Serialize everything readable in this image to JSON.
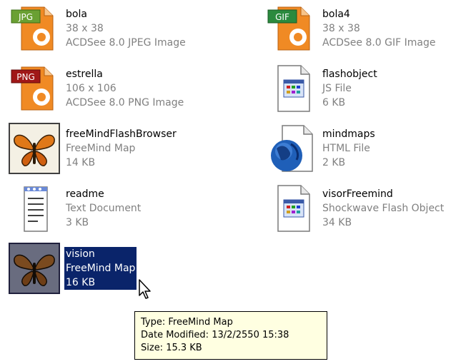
{
  "files": [
    {
      "name": "bola",
      "line2": "38 x 38",
      "line3": "ACDSee 8.0 JPEG Image",
      "icon": "jpg-image-icon",
      "badge": "JPG",
      "badge_color": "#6aa033"
    },
    {
      "name": "bola4",
      "line2": "38 x 38",
      "line3": "ACDSee 8.0 GIF Image",
      "icon": "gif-image-icon",
      "badge": "GIF",
      "badge_color": "#2b8a3e"
    },
    {
      "name": "estrella",
      "line2": "106 x 106",
      "line3": "ACDSee 8.0 PNG Image",
      "icon": "png-image-icon",
      "badge": "PNG",
      "badge_color": "#a01818"
    },
    {
      "name": "flashobject",
      "line2": "JS File",
      "line3": "6 KB",
      "icon": "script-file-icon"
    },
    {
      "name": "freeMindFlashBrowser",
      "line2": "FreeMind Map",
      "line3": "14 KB",
      "icon": "butterfly-icon"
    },
    {
      "name": "mindmaps",
      "line2": "HTML File",
      "line3": "2 KB",
      "icon": "html-globe-icon"
    },
    {
      "name": "readme",
      "line2": "Text Document",
      "line3": "3 KB",
      "icon": "text-document-icon"
    },
    {
      "name": "visorFreemind",
      "line2": "Shockwave Flash Object",
      "line3": "34 KB",
      "icon": "flash-object-icon"
    },
    {
      "name": "vision",
      "line2": "FreeMind Map",
      "line3": "16 KB",
      "icon": "butterfly-icon",
      "selected": true
    }
  ],
  "tooltip": {
    "type": "Type: FreeMind Map",
    "date": "Date Modified: 13/2/2550 15:38",
    "size": "Size: 15.3 KB"
  },
  "colors": {
    "selection": "#0a246a",
    "tooltip_bg": "#ffffe1",
    "detail_text": "#808080",
    "acdsee_orange": "#f08a24"
  }
}
